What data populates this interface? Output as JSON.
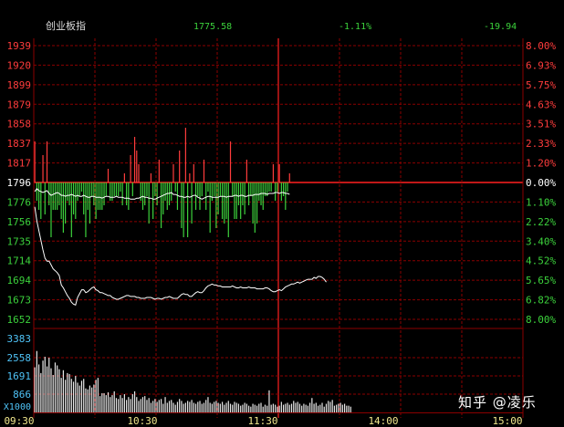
{
  "header": {
    "name": "创业板指",
    "price": "1775.58",
    "pct": "-1.11%",
    "change": "-19.94"
  },
  "watermark": "知乎 @凌乐",
  "colors": {
    "background": "#000000",
    "grid": "#8b0000",
    "up": "#ff3c3c",
    "down": "#3cd23c",
    "line": "#ffffff",
    "volume_label": "#4fc3f7",
    "time_label": "#f0e68c"
  },
  "chart_data": [
    {
      "type": "line",
      "series": [
        {
          "values": [
            1786,
            1789,
            1787,
            1786,
            1785,
            1786,
            1787,
            1784,
            1782,
            1783,
            1784,
            1785,
            1784,
            1782,
            1782,
            1781,
            1782,
            1782,
            1783,
            1782,
            1781,
            1782,
            1781,
            1781,
            1782,
            1781,
            1780,
            1780,
            1781,
            1781,
            1780,
            1780,
            1780,
            1779,
            1780,
            1781,
            1781,
            1780,
            1780,
            1780,
            1781,
            1780,
            1780,
            1780,
            1779,
            1779,
            1779,
            1778,
            1778,
            1778,
            1779,
            1779,
            1780,
            1781,
            1780,
            1780,
            1779,
            1779,
            1778,
            1778,
            1779,
            1780,
            1781,
            1782,
            1783,
            1784,
            1784,
            1785,
            1783,
            1783,
            1782,
            1781,
            1781,
            1780,
            1780,
            1781,
            1780,
            1781,
            1782,
            1782,
            1780,
            1779,
            1778,
            1779,
            1780,
            1781,
            1781,
            1780,
            1780,
            1780,
            1780,
            1781,
            1781,
            1781,
            1780,
            1781,
            1781,
            1781,
            1782,
            1782,
            1781,
            1782,
            1782,
            1781,
            1781,
            1782,
            1782,
            1782,
            1783,
            1783,
            1783,
            1784,
            1784,
            1784,
            1783,
            1784,
            1784,
            1784,
            1785,
            1785,
            1784,
            1785,
            1785,
            1784,
            1784,
            1783
          ]
        },
        {
          "values": [
            1770,
            1755,
            1745,
            1735,
            1725,
            1716,
            1713,
            1713,
            1709,
            1705,
            1703,
            1701,
            1698,
            1688,
            1685,
            1681,
            1677,
            1674,
            1670,
            1668,
            1667,
            1675,
            1679,
            1683,
            1683,
            1680,
            1681,
            1683,
            1685,
            1686,
            1683,
            1682,
            1680,
            1680,
            1679,
            1678,
            1677,
            1677,
            1675,
            1674,
            1673,
            1673,
            1674,
            1675,
            1676,
            1677,
            1677,
            1676,
            1676,
            1676,
            1675,
            1675,
            1674,
            1674,
            1674,
            1675,
            1675,
            1675,
            1674,
            1673,
            1674,
            1674,
            1673,
            1674,
            1675,
            1675,
            1676,
            1675,
            1674,
            1674,
            1674,
            1676,
            1678,
            1679,
            1678,
            1678,
            1676,
            1676,
            1678,
            1680,
            1681,
            1680,
            1680,
            1682,
            1685,
            1687,
            1688,
            1689,
            1688,
            1688,
            1687,
            1687,
            1686,
            1686,
            1686,
            1686,
            1686,
            1687,
            1686,
            1685,
            1685,
            1686,
            1685,
            1685,
            1685,
            1686,
            1685,
            1685,
            1685,
            1684,
            1684,
            1684,
            1684,
            1685,
            1685,
            1684,
            1682,
            1681,
            1681,
            1682,
            1683,
            1682,
            1684,
            1686,
            1687,
            1688,
            1689,
            1689,
            1690,
            1691,
            1690,
            1691,
            1692,
            1693,
            1694,
            1694,
            1694,
            1696,
            1695,
            1697,
            1697,
            1696,
            1694,
            1691
          ]
        }
      ],
      "yaxis_left": [
        "1939",
        "1920",
        "1899",
        "1879",
        "1858",
        "1837",
        "1817",
        "1796",
        "1776",
        "1756",
        "1735",
        "1714",
        "1694",
        "1673",
        "1652"
      ],
      "yaxis_right": [
        "8.00%",
        "6.93%",
        "5.75%",
        "4.63%",
        "3.51%",
        "2.33%",
        "1.20%",
        "0.00%",
        "1.10%",
        "2.22%",
        "3.40%",
        "4.52%",
        "5.65%",
        "6.82%",
        "8.00%"
      ],
      "ylim": [
        1652,
        1939
      ],
      "base": 1796
    },
    {
      "type": "bar",
      "title": "",
      "values": [
        9,
        -4,
        -6,
        -8,
        6,
        -7,
        9,
        -5,
        -12,
        -6,
        -6,
        -6,
        -5,
        -8,
        -11,
        -9,
        -4,
        -5,
        -12,
        -7,
        -8,
        -4,
        -3,
        -2,
        -7,
        -12,
        -6,
        -9,
        -3,
        -5,
        -8,
        -6,
        -6,
        -6,
        -5,
        -3,
        3,
        -4,
        -4,
        -3,
        -3,
        -3,
        -2,
        -5,
        2,
        -5,
        -6,
        6,
        -3,
        10,
        7,
        4,
        -4,
        -6,
        -5,
        -3,
        -9,
        2,
        -8,
        -3,
        -5,
        5,
        -10,
        -7,
        -4,
        -6,
        -5,
        -4,
        4,
        -2,
        -6,
        7,
        -10,
        -12,
        12,
        -12,
        2,
        -9,
        4,
        -6,
        -3,
        -6,
        -3,
        5,
        -6,
        -2,
        -11,
        -4,
        -3,
        -10,
        -7,
        -3,
        -8,
        -9,
        -8,
        -12,
        9,
        -3,
        -8,
        -8,
        -5,
        -8,
        -5,
        -7,
        5,
        -5,
        -3,
        -9,
        -11,
        -9,
        -4,
        -5,
        -6,
        -3,
        -3,
        -2,
        -2,
        4,
        -4,
        -2,
        4,
        -4,
        -3,
        -6,
        -2,
        2
      ],
      "ylim": [
        -12,
        12
      ]
    },
    {
      "type": "bar",
      "xlabel": "",
      "values": [
        2350,
        3200,
        2500,
        2050,
        2700,
        2900,
        2400,
        2850,
        2300,
        1950,
        2600,
        2450,
        2250,
        1800,
        2200,
        1700,
        2050,
        2000,
        1750,
        1600,
        1900,
        1550,
        1400,
        1650,
        1750,
        1250,
        1200,
        1400,
        1300,
        1450,
        1700,
        1800,
        850,
        1000,
        1000,
        900,
        1050,
        800,
        900,
        1100,
        750,
        700,
        900,
        750,
        950,
        650,
        800,
        700,
        950,
        1100,
        800,
        600,
        700,
        800,
        850,
        650,
        750,
        500,
        600,
        700,
        550,
        650,
        700,
        450,
        800,
        500,
        600,
        650,
        500,
        400,
        550,
        700,
        600,
        450,
        500,
        600,
        550,
        650,
        500,
        450,
        550,
        600,
        450,
        500,
        650,
        800,
        500,
        450,
        550,
        600,
        500,
        450,
        550,
        400,
        500,
        600,
        450,
        400,
        550,
        500,
        450,
        350,
        400,
        500,
        450,
        350,
        300,
        450,
        400,
        350,
        450,
        500,
        300,
        400,
        350,
        1150,
        400,
        450,
        400,
        300,
        350,
        550,
        400,
        450,
        500,
        400,
        450,
        600,
        500,
        550,
        450,
        350,
        450,
        400,
        350,
        500,
        750,
        450,
        500,
        350,
        400,
        500,
        300,
        450,
        600,
        550,
        650,
        350,
        400,
        450,
        500,
        400,
        450,
        350,
        350,
        300
      ],
      "yaxis": [
        "3383",
        "2558",
        "1691",
        "866"
      ],
      "ylim": [
        0,
        3900
      ],
      "unit": "X1000"
    }
  ],
  "xaxis": [
    "09:30",
    "10:30",
    "11:30",
    "14:00",
    "15:00"
  ]
}
